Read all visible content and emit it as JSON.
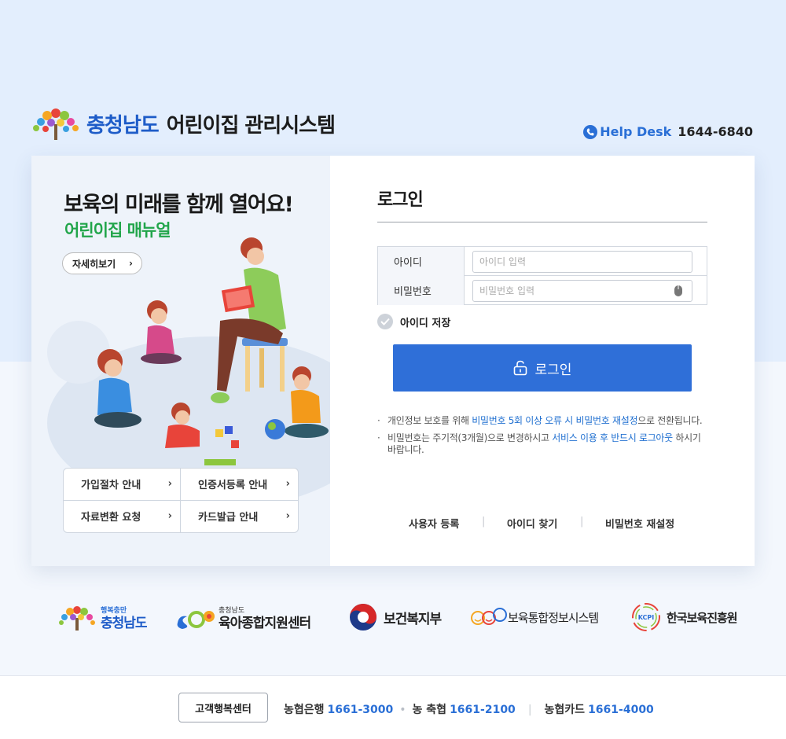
{
  "header": {
    "province": "충청남도",
    "system_name": "어린이집 관리시스템",
    "helpdesk_label": "Help Desk",
    "helpdesk_number": "1644-6840"
  },
  "promo": {
    "headline": "보육의 미래를 함께 열어요!",
    "subline": "어린이집 매뉴얼",
    "more_label": "자세히보기",
    "quick_links": [
      "가입절차 안내",
      "인증서등록 안내",
      "자료변환 요청",
      "카드발급 안내"
    ]
  },
  "login": {
    "title": "로그인",
    "id_label": "아이디",
    "id_placeholder": "아이디 입력",
    "pw_label": "비밀번호",
    "pw_placeholder": "비밀번호 입력",
    "save_id_label": "아이디 저장",
    "button_label": "로그인",
    "notice1_pre": "개인정보 보호를 위해 ",
    "notice1_hl": "비밀번호 5회 이상 오류 시 비밀번호 재설정",
    "notice1_post": "으로 전환됩니다.",
    "notice2_pre": "비밀번호는 주기적(3개월)으로 변경하시고 ",
    "notice2_hl": "서비스 이용 후 반드시 로그아웃",
    "notice2_post": " 하시기 바랍니다.",
    "link_register": "사용자 등록",
    "link_find_id": "아이디 찾기",
    "link_reset_pw": "비밀번호 재설정"
  },
  "partners": {
    "p1_small": "행복충만",
    "p1_name": "충청남도",
    "p2_small": "충청남도",
    "p2_name": "육아종합지원센터",
    "p3_name": "보건복지부",
    "p4_name": "보육통합정보시스템",
    "p5_badge": "KCPI",
    "p5_name": "한국보육진흥원"
  },
  "footer": {
    "cs_label": "고객행복센터",
    "bank1_name": "농협은행",
    "bank1_num": "1661-3000",
    "bank2_name": "농 축협",
    "bank2_num": "1661-2100",
    "bank3_name": "농협카드",
    "bank3_num": "1661-4000"
  },
  "colors": {
    "accent": "#2f6fd8",
    "brand_blue": "#1e5cc8",
    "green": "#21a54a"
  }
}
